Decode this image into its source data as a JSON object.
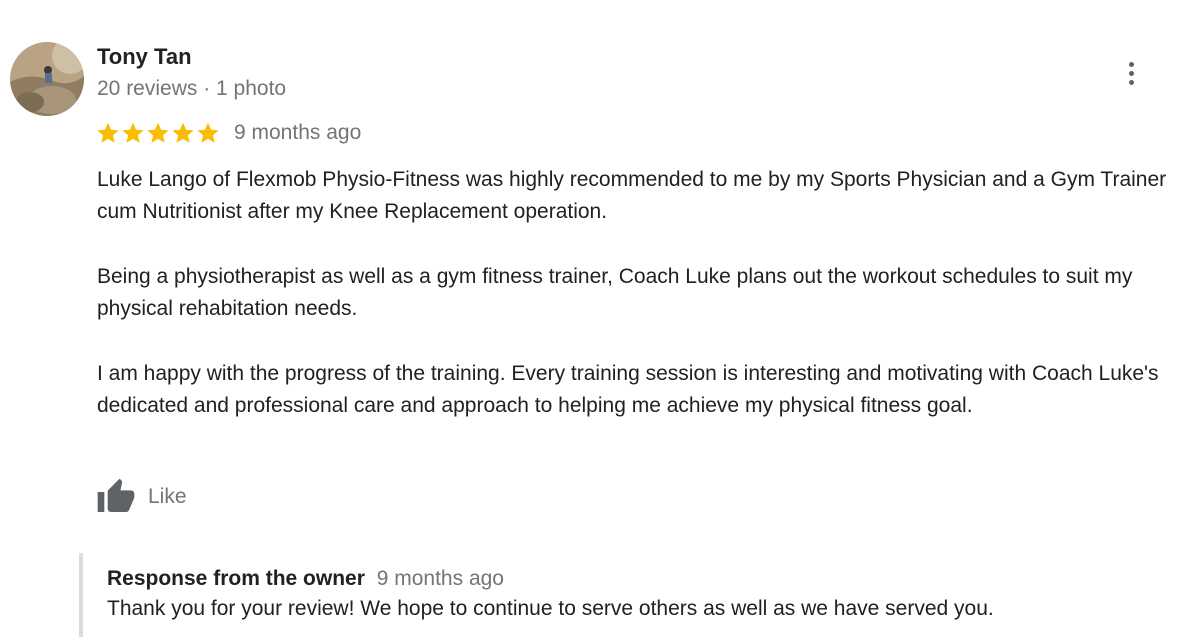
{
  "review": {
    "reviewer_name": "Tony Tan",
    "reviewer_meta": "20 reviews · 1 photo",
    "rating": 5,
    "rating_max": 5,
    "age": "9 months ago",
    "paragraphs": [
      "Luke Lango of Flexmob Physio-Fitness was highly recommended to me by my Sports Physician and a Gym Trainer cum Nutritionist after my Knee Replacement operation.",
      "Being a physiotherapist as well as a gym fitness trainer, Coach Luke plans out the workout schedules to suit my physical rehabitation needs.",
      "I am happy with the progress of the training. Every training session is interesting and motivating with Coach Luke's dedicated and professional care and approach to helping me achieve my physical fitness goal."
    ],
    "like_label": "Like",
    "more_icon": "more-vert-icon",
    "like_icon": "thumb-up-icon",
    "star_icon": "star-icon",
    "star_color": "#fbbc04",
    "icon_color": "#5f6368"
  },
  "owner_response": {
    "title": "Response from the owner",
    "age": "9 months ago",
    "text": "Thank you for your review! We hope to continue to serve others as well as we have served you."
  }
}
